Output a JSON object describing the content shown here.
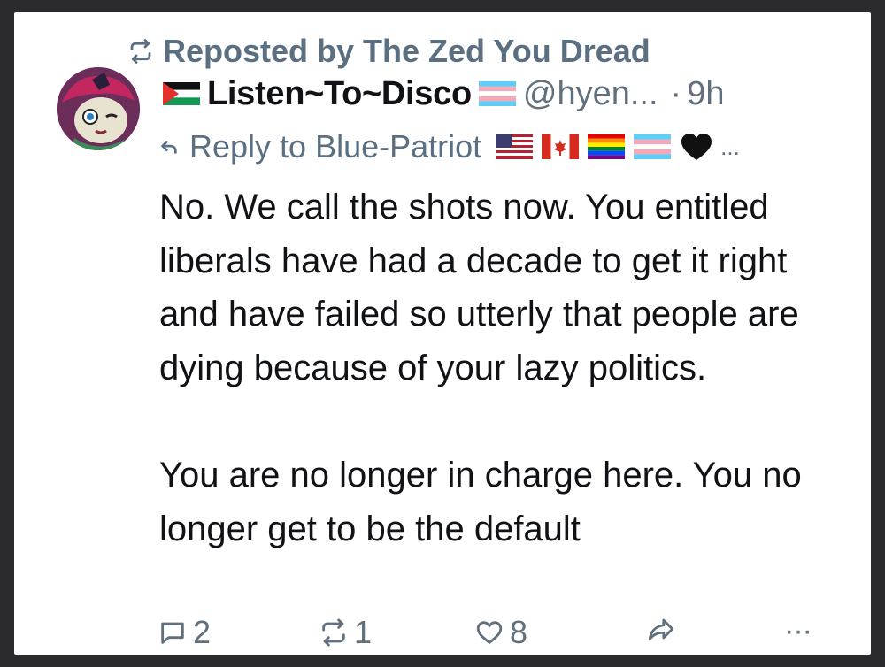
{
  "repost": {
    "label": "Reposted by The Zed You Dread",
    "icon": "repost-icon"
  },
  "post": {
    "author_name": "Listen~To~Disco",
    "author_prefix_flag": "palestine-flag-icon",
    "author_suffix_flag": "transgender-flag-icon",
    "handle": "@hyen...",
    "separator": "·",
    "time": "9h",
    "reply_to_label": "Reply to Blue-Patriot",
    "reply_to_badges": [
      "us-flag-icon",
      "canada-flag-icon",
      "rainbow-flag-icon",
      "transgender-flag-icon",
      "black-heart-icon"
    ],
    "reply_to_more": "...",
    "text": {
      "paragraph1": "No. We call the shots now. You entitled liberals have had a decade to get it right and have failed so utterly that people are dying because of your lazy politics.",
      "paragraph2": "You are no longer in charge here. You no longer get to be the default"
    }
  },
  "actions": {
    "reply_count": "2",
    "repost_count": "1",
    "like_count": "8",
    "more_label": "···"
  },
  "colors": {
    "muted_text": "#62707d",
    "body_text": "#101215",
    "background": "#ffffff",
    "frame": "#2b2b2d"
  }
}
